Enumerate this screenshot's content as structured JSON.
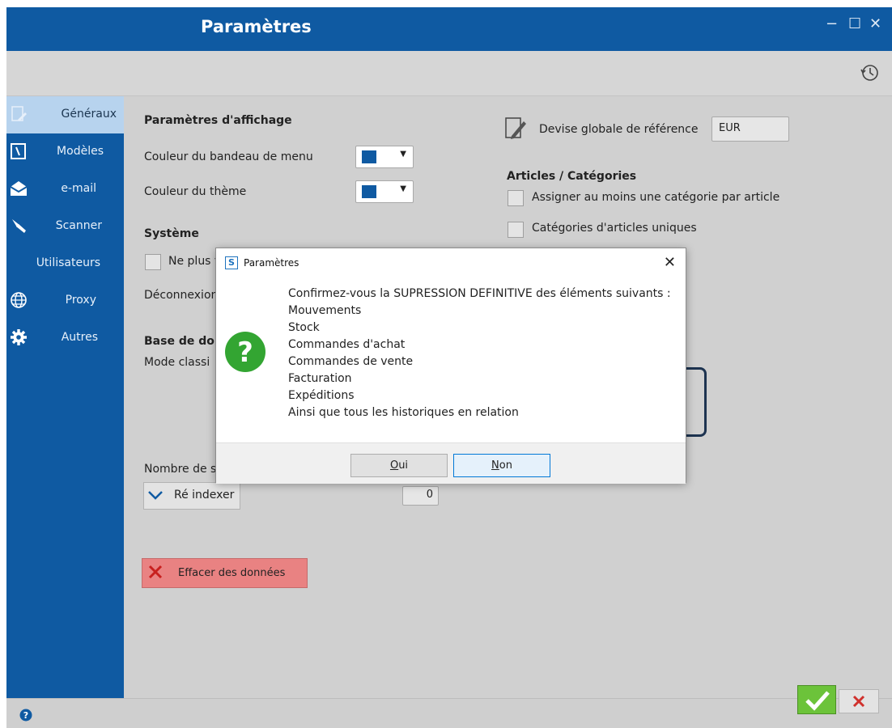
{
  "window": {
    "title": "Paramètres",
    "controls": [
      "minimize",
      "maximize",
      "close"
    ]
  },
  "sidebar": {
    "items": [
      {
        "label": "Généraux",
        "icon": "edit-doc-icon",
        "active": true
      },
      {
        "label": "Modèles",
        "icon": "template-icon"
      },
      {
        "label": "e-mail",
        "icon": "envelope-icon"
      },
      {
        "label": "Scanner",
        "icon": "scanner-icon"
      },
      {
        "label": "Utilisateurs",
        "icon": ""
      },
      {
        "label": "Proxy",
        "icon": "globe-icon"
      },
      {
        "label": "Autres",
        "icon": "gear-icon"
      }
    ]
  },
  "display": {
    "heading": "Paramètres d'affichage",
    "menu_band_color_label": "Couleur du bandeau de menu",
    "theme_color_label": "Couleur du thème",
    "swatch_color": "#0f5aa2"
  },
  "system": {
    "heading": "Système",
    "no_more_label": "Ne plus v",
    "logout_label": "Déconnexion"
  },
  "database": {
    "heading": "Base de don",
    "mode_label": "Mode classi",
    "count_label": "Nombre de s",
    "reindex_label": "Ré indexer",
    "count_value": "0",
    "delete_label": "Effacer des données"
  },
  "currency": {
    "label": "Devise globale de référence",
    "value": "EUR"
  },
  "articles": {
    "heading": "Articles / Catégories",
    "assign_label": "Assigner au moins une catégorie par article",
    "unique_label": "Catégories d'articles uniques"
  },
  "dialog": {
    "title": "Paramètres",
    "app_letter": "S",
    "message_lines": [
      "Confirmez-vous la SUPRESSION DEFINITIVE des éléments suivants :",
      "Mouvements",
      "Stock",
      "Commandes d'achat",
      "Commandes de vente",
      "Facturation",
      "Expéditions",
      "Ainsi que tous les historiques en relation"
    ],
    "yes_key": "O",
    "yes_rest": "ui",
    "no_key": "N",
    "no_rest": "on"
  },
  "colors": {
    "primary": "#0f5aa2",
    "danger": "#e98282",
    "confirm": "#6cc33a",
    "cancel_x": "#d0312d",
    "help": "#0f5aa2"
  }
}
